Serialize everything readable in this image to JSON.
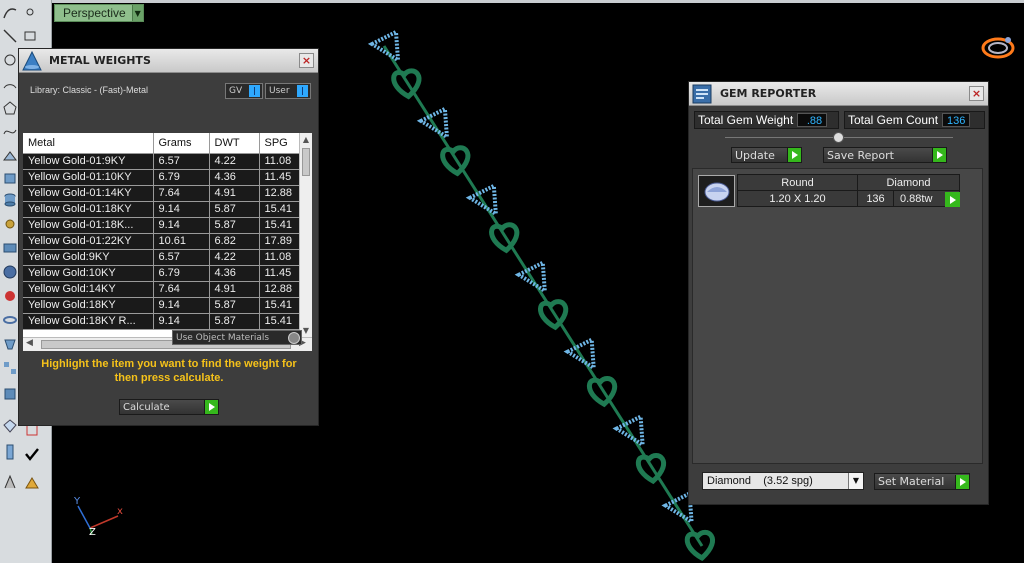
{
  "viewport": {
    "label": "Perspective",
    "axes": {
      "x": "x",
      "y": "y",
      "z": "z"
    }
  },
  "metal_weights": {
    "title": "METAL WEIGHTS",
    "library_label": "Library: Classic - (Fast)-Metal",
    "gv_label": "GV",
    "user_label": "User",
    "columns": [
      "Metal",
      "Grams",
      "DWT",
      "SPG"
    ],
    "rows": [
      [
        "Yellow Gold-01:9KY",
        "6.57",
        "4.22",
        "11.08"
      ],
      [
        "Yellow Gold-01:10KY",
        "6.79",
        "4.36",
        "11.45"
      ],
      [
        "Yellow Gold-01:14KY",
        "7.64",
        "4.91",
        "12.88"
      ],
      [
        "Yellow Gold-01:18KY",
        "9.14",
        "5.87",
        "15.41"
      ],
      [
        "Yellow Gold-01:18K...",
        "9.14",
        "5.87",
        "15.41"
      ],
      [
        "Yellow Gold-01:22KY",
        "10.61",
        "6.82",
        "17.89"
      ],
      [
        "Yellow Gold:9KY",
        "6.57",
        "4.22",
        "11.08"
      ],
      [
        "Yellow Gold:10KY",
        "6.79",
        "4.36",
        "11.45"
      ],
      [
        "Yellow Gold:14KY",
        "7.64",
        "4.91",
        "12.88"
      ],
      [
        "Yellow Gold:18KY",
        "9.14",
        "5.87",
        "15.41"
      ],
      [
        "Yellow Gold:18KY R...",
        "9.14",
        "5.87",
        "15.41"
      ]
    ],
    "use_object_materials": "Use Object Materials",
    "hint": "Highlight the item you want to find the weight for then press calculate.",
    "calculate_label": "Calculate"
  },
  "gem_reporter": {
    "title": "GEM REPORTER",
    "total_weight_label": "Total Gem Weight",
    "total_weight_value": ".88",
    "total_count_label": "Total Gem Count",
    "total_count_value": "136",
    "update_label": "Update",
    "save_report_label": "Save Report",
    "gem": {
      "shape": "Round",
      "material": "Diamond",
      "size": "1.20 X 1.20",
      "count": "136",
      "weight": "0.88tw"
    },
    "material_select": "Diamond    (3.52 spg)",
    "set_material_label": "Set Material"
  },
  "colors": {
    "go_green": "#35b81c",
    "heart_green": "#1f7a52",
    "stone_blue": "#6fb6e6",
    "accent_orange": "#ff7a1a"
  }
}
